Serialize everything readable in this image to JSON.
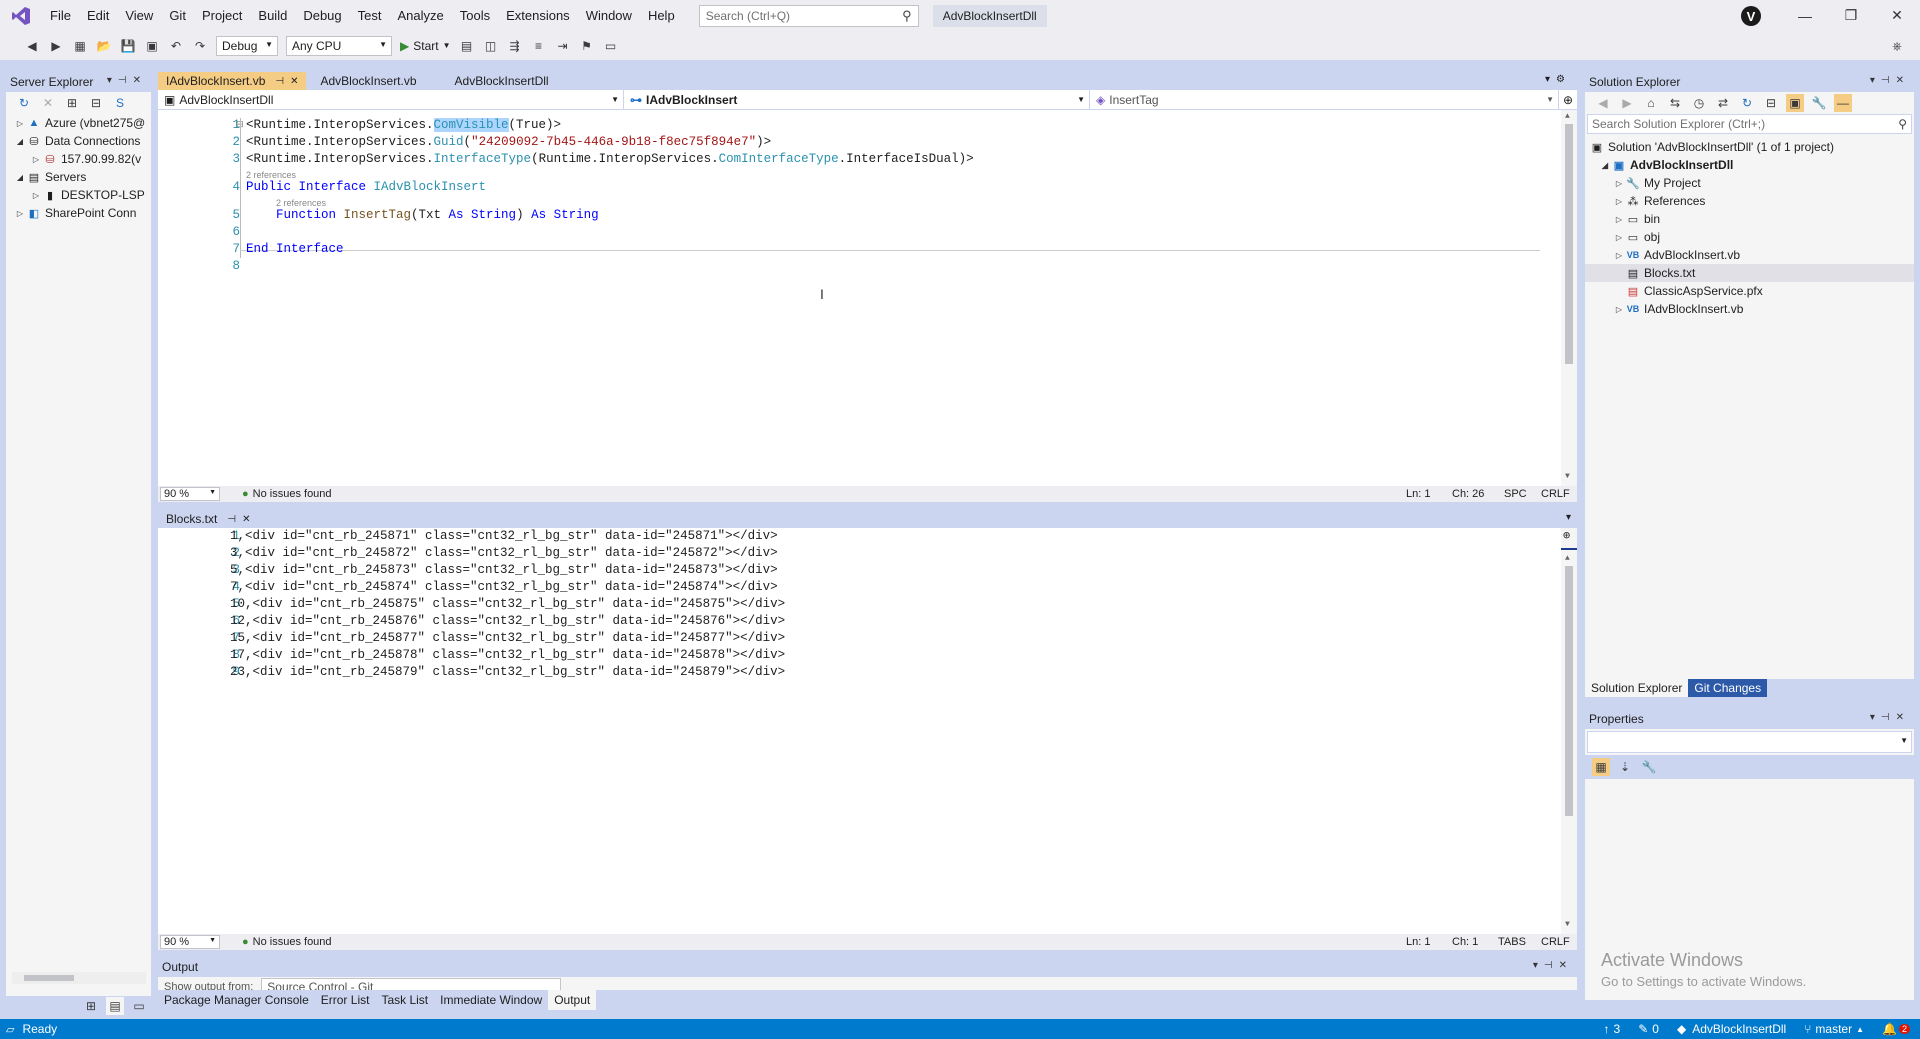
{
  "menu": [
    "File",
    "Edit",
    "View",
    "Git",
    "Project",
    "Build",
    "Debug",
    "Test",
    "Analyze",
    "Tools",
    "Extensions",
    "Window",
    "Help"
  ],
  "search": {
    "placeholder": "Search (Ctrl+Q)"
  },
  "solution_name": "AdvBlockInsertDll",
  "avatar_letter": "V",
  "toolbar": {
    "config": "Debug",
    "platform": "Any CPU",
    "start": "Start"
  },
  "server_explorer": {
    "title": "Server Explorer",
    "items": [
      {
        "label": "Azure (vbnet275@",
        "level": 0,
        "expand": "▷"
      },
      {
        "label": "Data Connections",
        "level": 0,
        "expand": "◢"
      },
      {
        "label": "157.90.99.82(v",
        "level": 1,
        "expand": "▷"
      },
      {
        "label": "Servers",
        "level": 0,
        "expand": "◢"
      },
      {
        "label": "DESKTOP-LSP",
        "level": 1,
        "expand": "▷"
      },
      {
        "label": "SharePoint Conn",
        "level": 0,
        "expand": "▷"
      }
    ]
  },
  "editor1": {
    "tabs": [
      "IAdvBlockInsert.vb",
      "AdvBlockInsert.vb",
      "AdvBlockInsertDll"
    ],
    "nav": [
      "AdvBlockInsertDll",
      "IAdvBlockInsert",
      "InsertTag"
    ],
    "line_numbers": [
      "1",
      "2",
      "3",
      "4",
      "5",
      "6",
      "7",
      "8"
    ],
    "code": {
      "l1a": "<Runtime.InteropServices.",
      "l1b": "ComVisible",
      "l1c": "(True)>",
      "l2a": "<Runtime.InteropServices.",
      "l2b": "Guid",
      "l2c": "(",
      "l2d": "\"24209092-7b45-446a-9b18-f8ec75f894e7\"",
      "l2e": ")>",
      "l3a": "<Runtime.InteropServices.",
      "l3b": "InterfaceType",
      "l3c": "(Runtime.InteropServices.",
      "l3d": "ComInterfaceType",
      "l3e": ".InterfaceIsDual)>",
      "lens1": "2 references",
      "l4a": "Public Interface ",
      "l4b": "IAdvBlockInsert",
      "lens2": "2 references",
      "l5a": "Function ",
      "l5b": "InsertTag",
      "l5c": "(Txt ",
      "l5d": "As String",
      "l5e": ") ",
      "l5f": "As String",
      "l7": "End Interface"
    },
    "status": {
      "zoom": "90 %",
      "issues": "No issues found",
      "ln": "Ln: 1",
      "ch": "Ch: 26",
      "mode": "SPC",
      "eol": "CRLF"
    }
  },
  "editor2": {
    "tab": "Blocks.txt",
    "line_numbers": [
      "1",
      "2",
      "3",
      "4",
      "5",
      "6",
      "7",
      "8",
      "9"
    ],
    "lines": [
      "1,<div id=\"cnt_rb_245871\" class=\"cnt32_rl_bg_str\" data-id=\"245871\"></div>",
      "3,<div id=\"cnt_rb_245872\" class=\"cnt32_rl_bg_str\" data-id=\"245872\"></div>",
      "5,<div id=\"cnt_rb_245873\" class=\"cnt32_rl_bg_str\" data-id=\"245873\"></div>",
      "7,<div id=\"cnt_rb_245874\" class=\"cnt32_rl_bg_str\" data-id=\"245874\"></div>",
      "10,<div id=\"cnt_rb_245875\" class=\"cnt32_rl_bg_str\" data-id=\"245875\"></div>",
      "12,<div id=\"cnt_rb_245876\" class=\"cnt32_rl_bg_str\" data-id=\"245876\"></div>",
      "15,<div id=\"cnt_rb_245877\" class=\"cnt32_rl_bg_str\" data-id=\"245877\"></div>",
      "17,<div id=\"cnt_rb_245878\" class=\"cnt32_rl_bg_str\" data-id=\"245878\"></div>",
      "23,<div id=\"cnt_rb_245879\" class=\"cnt32_rl_bg_str\" data-id=\"245879\"></div>"
    ],
    "status": {
      "zoom": "90 %",
      "issues": "No issues found",
      "ln": "Ln: 1",
      "ch": "Ch: 1",
      "mode": "TABS",
      "eol": "CRLF"
    }
  },
  "output": {
    "title": "Output",
    "show_from": "Show output from:",
    "source": "Source Control - Git"
  },
  "bottom_tabs": [
    "Package Manager Console",
    "Error List",
    "Task List",
    "Immediate Window",
    "Output"
  ],
  "solution_explorer": {
    "title": "Solution Explorer",
    "search_placeholder": "Search Solution Explorer (Ctrl+;)",
    "solution": "Solution 'AdvBlockInsertDll' (1 of 1 project)",
    "project": "AdvBlockInsertDll",
    "items": [
      {
        "label": "My Project",
        "icon": "wrench-icon"
      },
      {
        "label": "References",
        "icon": "references-icon"
      },
      {
        "label": "bin",
        "icon": "folder-icon"
      },
      {
        "label": "obj",
        "icon": "folder-icon"
      },
      {
        "label": "AdvBlockInsert.vb",
        "icon": "vb-file-icon"
      },
      {
        "label": "Blocks.txt",
        "icon": "text-file-icon"
      },
      {
        "label": "ClassicAspService.pfx",
        "icon": "certificate-icon"
      },
      {
        "label": "IAdvBlockInsert.vb",
        "icon": "vb-file-icon"
      }
    ],
    "tabs": [
      "Solution Explorer",
      "Git Changes"
    ]
  },
  "properties": {
    "title": "Properties"
  },
  "watermark": {
    "line1": "Activate Windows",
    "line2": "Go to Settings to activate Windows."
  },
  "statusbar": {
    "ready": "Ready",
    "up_count": "3",
    "pencil_count": "0",
    "repo": "AdvBlockInsertDll",
    "branch": "master",
    "notif": "2"
  },
  "colors": {
    "accent": "#007acc",
    "active_tab": "#f5cc84",
    "chrome": "#eeeef2",
    "panel_bg": "#ccd5f0",
    "keyword": "#0000ff",
    "type": "#2b91af",
    "string": "#a31515"
  }
}
